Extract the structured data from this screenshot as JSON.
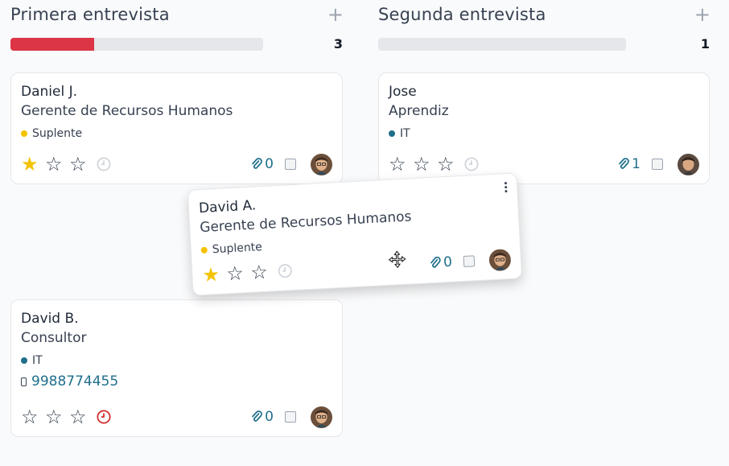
{
  "columns": [
    {
      "title": "Primera entrevista",
      "count": "3",
      "progress": 0.33,
      "progress_color": "#dc3545"
    },
    {
      "title": "Segunda entrevista",
      "count": "1",
      "progress": 0,
      "progress_color": "#dc3545"
    }
  ],
  "cards": {
    "daniel": {
      "name": "Daniel J.",
      "job": "Gerente de Recursos Humanos",
      "tag": "Suplente",
      "tag_color": "#f3c300",
      "stars": 1,
      "attachments": "0"
    },
    "jose": {
      "name": "Jose",
      "job": "Aprendiz",
      "tag": "IT",
      "tag_color": "#1f6f8b",
      "stars": 0,
      "attachments": "1"
    },
    "david_a": {
      "name": "David A.",
      "job": "Gerente de Recursos Humanos",
      "tag": "Suplente",
      "tag_color": "#f3c300",
      "stars": 1,
      "attachments": "0"
    },
    "david_b": {
      "name": "David B.",
      "job": "Consultor",
      "tag": "IT",
      "tag_color": "#1f6f8b",
      "phone": "9988774455",
      "stars": 0,
      "attachments": "0",
      "activity": "overdue"
    }
  },
  "icons": {
    "add": "+",
    "star_filled": "★",
    "star_empty": "☆"
  },
  "colors": {
    "accent_link": "#1f6f8b",
    "star": "#f3c300",
    "overdue": "#d32f2f",
    "progress_empty": "#e5e7eb"
  }
}
